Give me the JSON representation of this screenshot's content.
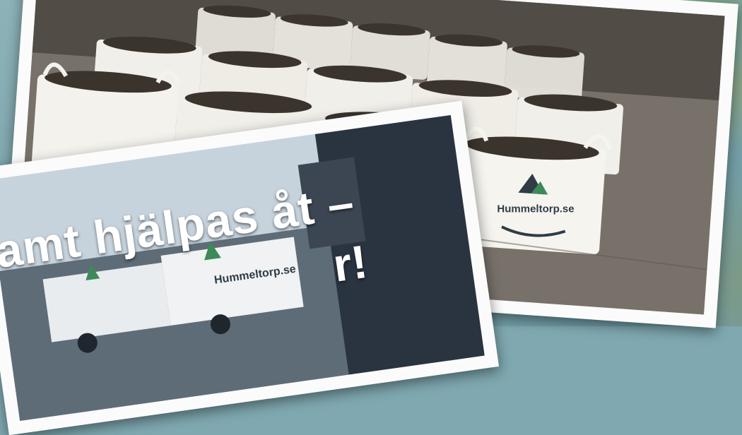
{
  "headline": {
    "line1": "amt hjälpas åt –",
    "line2": "r!"
  },
  "brand": {
    "bag_label": "Hummeltorp.se",
    "truck_label": "Hummeltorp.se"
  },
  "colors": {
    "backdrop_water": "#79a3ab",
    "frame": "#fbfbfb",
    "bag_white": "#f1efe9",
    "soil": "#3b342d",
    "brand_green": "#3c8a5a",
    "brand_dark": "#2f3c46"
  }
}
